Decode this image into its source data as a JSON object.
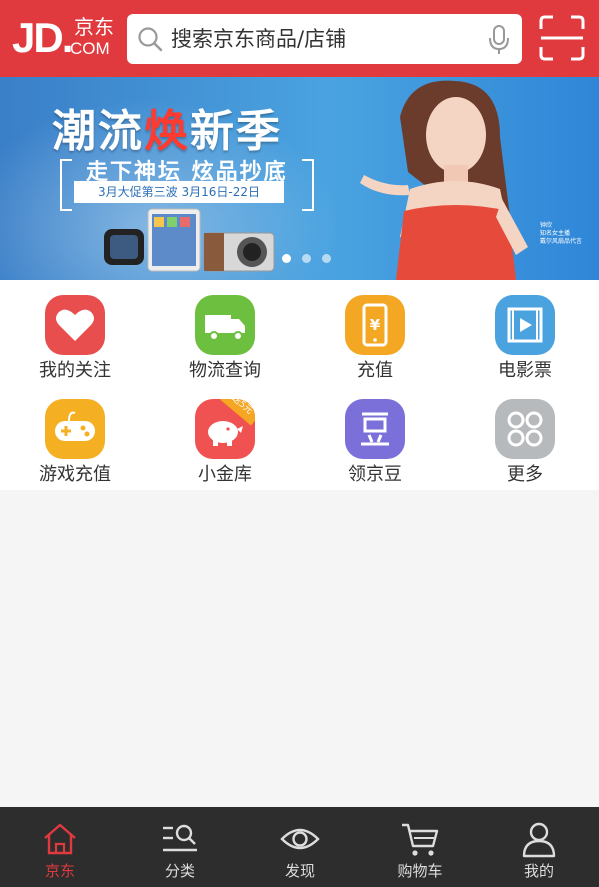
{
  "header": {
    "logo": {
      "jd": "JD.",
      "cn": "京东",
      "com": "COM"
    },
    "search_placeholder": "搜索京东商品/店铺",
    "icons": {
      "search": "search-icon",
      "mic": "microphone-icon",
      "scan": "scan-icon"
    }
  },
  "banner": {
    "title_part1": "潮流",
    "title_highlight": "焕",
    "title_part2": "新季",
    "subtitle": "走下神坛  炫品抄底",
    "date": "3月大促第三波 3月16日-22日",
    "carousel": {
      "count": 3,
      "active": 1
    },
    "caption_lines": [
      "钟欣",
      "知名女主播",
      "戴尔风扇品代言"
    ]
  },
  "grid": {
    "items": [
      {
        "label": "我的关注",
        "icon": "heart-icon",
        "color": "#e94e4e"
      },
      {
        "label": "物流查询",
        "icon": "truck-icon",
        "color": "#6cbf3f"
      },
      {
        "label": "充值",
        "icon": "phone-yen-icon",
        "color": "#f4a722"
      },
      {
        "label": "电影票",
        "icon": "film-icon",
        "color": "#4aa3df"
      },
      {
        "label": "游戏充值",
        "icon": "gamepad-icon",
        "color": "#f4b022"
      },
      {
        "label": "小金库",
        "icon": "piggy-bank-icon",
        "color": "#ef5250",
        "badge": "送5元"
      },
      {
        "label": "领京豆",
        "icon": "bean-icon",
        "color": "#7b6fd9"
      },
      {
        "label": "更多",
        "icon": "more-icon",
        "color": "#b7babd"
      }
    ]
  },
  "tabbar": {
    "items": [
      {
        "label": "京东",
        "icon": "home-icon",
        "active": true
      },
      {
        "label": "分类",
        "icon": "category-icon",
        "active": false
      },
      {
        "label": "发现",
        "icon": "discover-eye-icon",
        "active": false
      },
      {
        "label": "购物车",
        "icon": "cart-icon",
        "active": false
      },
      {
        "label": "我的",
        "icon": "user-icon",
        "active": false
      }
    ]
  },
  "colors": {
    "brand_red": "#e0393e",
    "tabbar_bg": "#2d2d2d",
    "page_bg": "#f5f5f5"
  }
}
